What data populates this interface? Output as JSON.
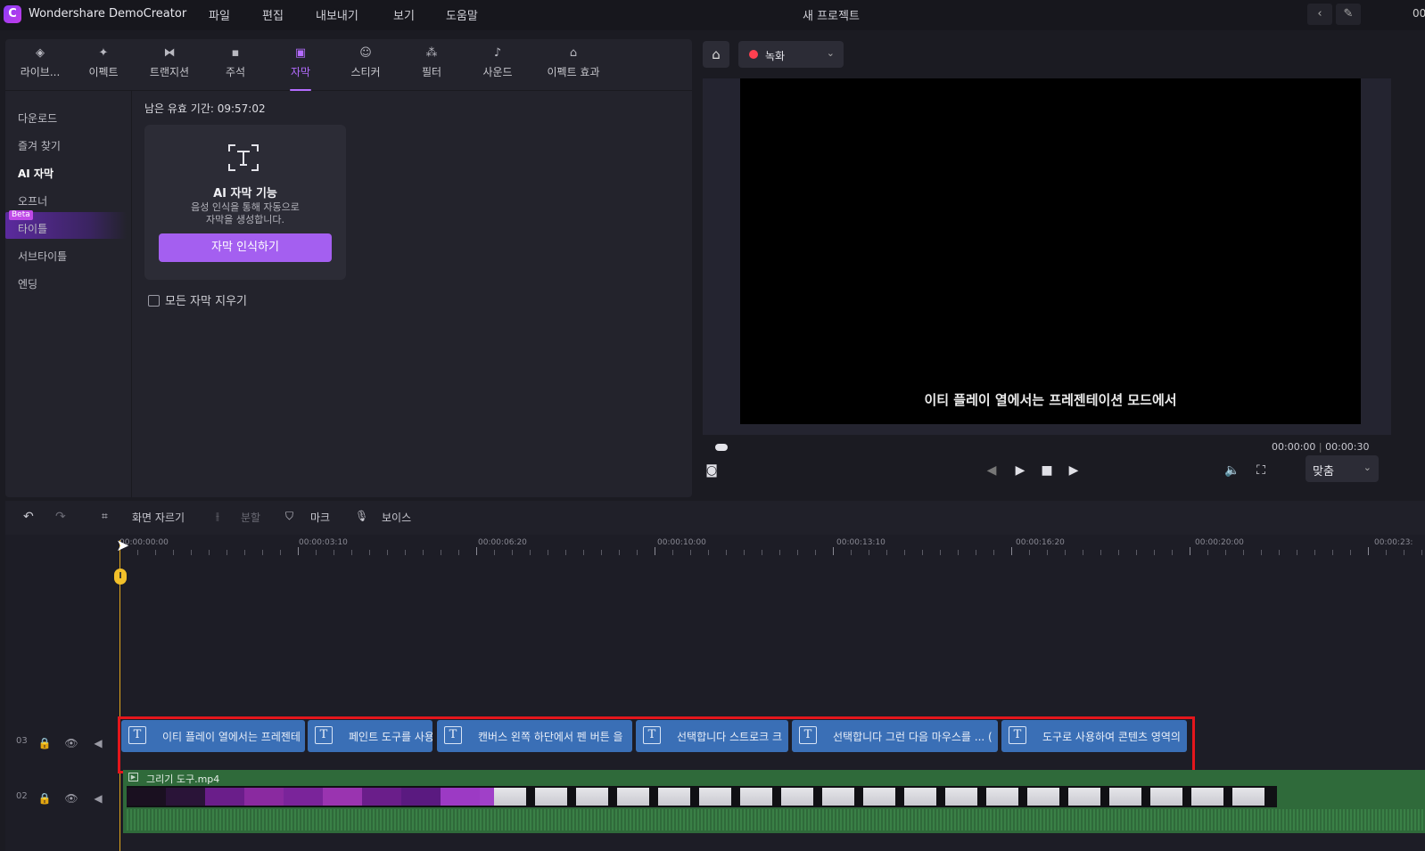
{
  "titlebar": {
    "app_name": "Wondershare DemoCreator",
    "menu": [
      "파일",
      "편집",
      "내보내기",
      "보기",
      "도움말"
    ],
    "project_title": "새 프로젝트",
    "right_timecode": "00"
  },
  "library": {
    "tabs": [
      {
        "label": "라이브...",
        "icon": "layers-icon"
      },
      {
        "label": "이펙트",
        "icon": "sparkle-icon"
      },
      {
        "label": "트랜지션",
        "icon": "transition-icon"
      },
      {
        "label": "주석",
        "icon": "annotation-icon"
      },
      {
        "label": "자막",
        "icon": "caption-icon"
      },
      {
        "label": "스티커",
        "icon": "sticker-icon"
      },
      {
        "label": "필터",
        "icon": "filter-icon"
      },
      {
        "label": "사운드",
        "icon": "music-icon"
      },
      {
        "label": "이펙트 효과",
        "icon": "effect-pack-icon"
      }
    ],
    "active_tab": "자막",
    "sidebar": [
      "다운로드",
      "즐겨 찾기",
      "AI 자막",
      "오프너",
      "타이틀",
      "서브타이틀",
      "엔딩"
    ],
    "beta_badge": "Beta",
    "remaining_time": "남은 유효 기간: 09:57:02",
    "ai_card": {
      "title": "AI 자막 기능",
      "desc_line1": "음성 인식을 통해 자동으로",
      "desc_line2": "자막을 생성합니다.",
      "button": "자막 인식하기"
    },
    "clear_all": "모든 자막 지우기"
  },
  "preview": {
    "record_label": "녹화",
    "caption": "이티 플레이 열에서는 프레젠테이션 모드에서",
    "time_current": "00:00:00",
    "time_total": "00:00:30",
    "progress": 0,
    "fit_label": "맞춤"
  },
  "toolbar": {
    "crop": "화면 자르기",
    "split": "분할",
    "mark": "마크",
    "voice": "보이스"
  },
  "timeline": {
    "ruler_labels": [
      "00:00:00:00",
      "00:00:03:10",
      "00:00:06:20",
      "00:00:10:00",
      "00:00:13:10",
      "00:00:16:20",
      "00:00:20:00",
      "00:00:23:"
    ],
    "tracks": [
      {
        "num": "03"
      },
      {
        "num": "02"
      }
    ],
    "caption_clips": [
      "이티 플레이 열에서는 프레젠테",
      "페인트 도구를 사용",
      "캔버스 왼쪽 하단에서 펜 버튼 을",
      "선택합니다 스트로크 크",
      "선택합니다 그런 다음 마우스를 ... (",
      "도구로 사용하여 콘텐츠 영역의"
    ],
    "video_clip_name": "그리기 도구.mp4"
  },
  "colors": {
    "accent": "#a45ff0",
    "caption_clip": "#3a6fb6",
    "video_clip": "#2f6a3a",
    "highlight": "#e4161c",
    "playhead": "#e3a81c"
  }
}
